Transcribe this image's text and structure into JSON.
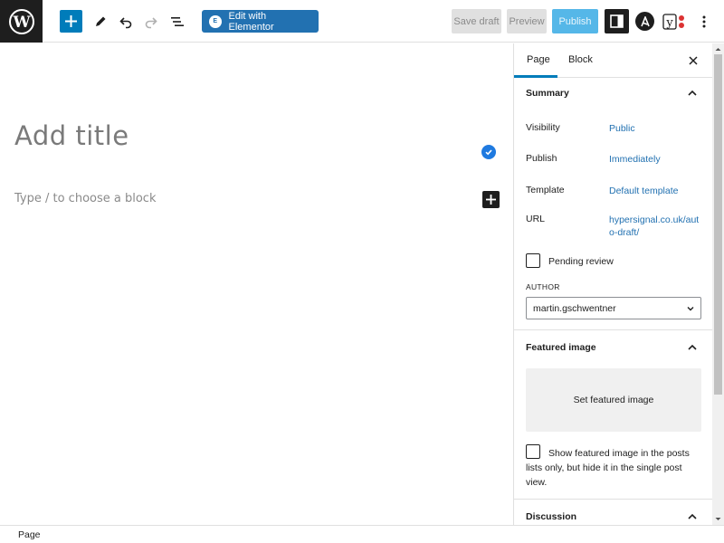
{
  "toolbar": {
    "elementor_label": "Edit with Elementor",
    "elementor_badge": "E",
    "save_draft_label": "Save draft",
    "preview_label": "Preview",
    "publish_label": "Publish",
    "yoast_letter": "y/"
  },
  "editor": {
    "title_placeholder": "Add title",
    "block_placeholder": "Type / to choose a block"
  },
  "sidebar": {
    "tabs": [
      {
        "label": "Page",
        "active": true
      },
      {
        "label": "Block",
        "active": false
      }
    ],
    "summary": {
      "title": "Summary",
      "rows": [
        {
          "label": "Visibility",
          "value": "Public"
        },
        {
          "label": "Publish",
          "value": "Immediately"
        },
        {
          "label": "Template",
          "value": "Default template"
        },
        {
          "label": "URL",
          "value": "hypersignal.co.uk/auto-draft/",
          "value_line1": "hypersignal.co.uk/aut",
          "value_line2": "o-draft/"
        }
      ],
      "pending_review_label": "Pending review",
      "pending_review_checked": false,
      "author_label": "AUTHOR",
      "author_value": "martin.gschwentner"
    },
    "featured_image": {
      "title": "Featured image",
      "set_label": "Set featured image",
      "hide_note": "Show featured image in the posts lists only, but hide it in the single post view.",
      "hide_note_line1": "Show featured image in the posts",
      "hide_note_line2": "lists only, but hide it in the single post",
      "hide_note_line3": "view.",
      "hide_checked": false
    },
    "discussion": {
      "title": "Discussion"
    }
  },
  "footer": {
    "breadcrumb": "Page"
  },
  "colors": {
    "accent": "#007cba",
    "link": "#2271b1",
    "publish_disabled": "#55b7e8",
    "dark": "#1e1e1e"
  }
}
